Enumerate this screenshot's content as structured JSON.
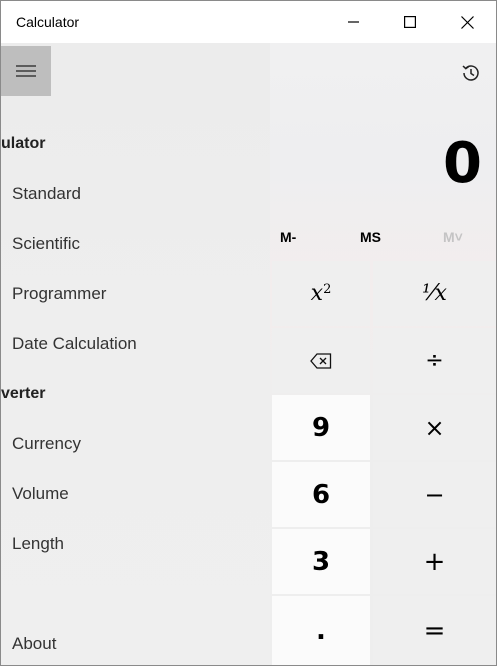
{
  "window": {
    "title": "Calculator",
    "minimize_icon": "minimize-icon",
    "maximize_icon": "maximize-icon",
    "close_icon": "close-icon"
  },
  "nav": {
    "menu_icon": "hamburger-icon",
    "sections": [
      {
        "heading": "ulator",
        "items": [
          "Standard",
          "Scientific",
          "Programmer",
          "Date Calculation"
        ]
      },
      {
        "heading": "verter",
        "items": [
          "Currency",
          "Volume",
          "Length"
        ]
      }
    ],
    "about": "About"
  },
  "calculator": {
    "history_icon": "history-icon",
    "display": "0",
    "memory": {
      "m_minus": "M-",
      "ms": "MS",
      "m_view": "M˅"
    },
    "keys": {
      "square": "x",
      "square_exp": "2",
      "reciprocal": "⅟x",
      "backspace_icon": "backspace-icon",
      "divide": "÷",
      "nine": "9",
      "multiply": "×",
      "six": "6",
      "minus": "−",
      "three": "3",
      "plus": "+",
      "decimal": ".",
      "equals": "="
    }
  }
}
